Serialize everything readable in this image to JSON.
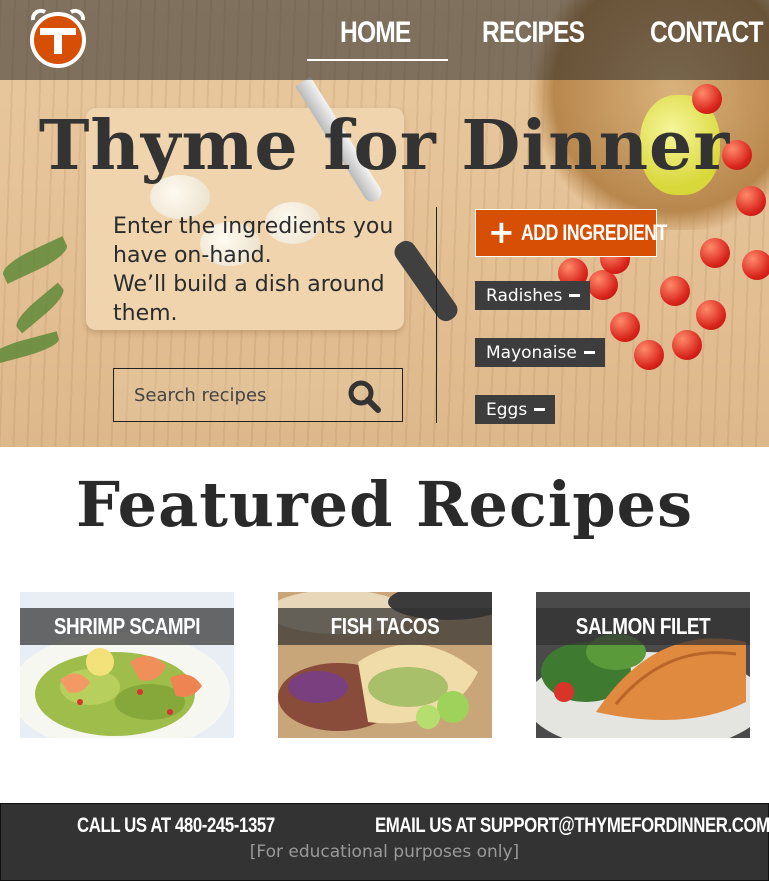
{
  "nav": {
    "logo_icon": "clock-t-logo",
    "links": [
      {
        "label": "HOME",
        "active": true
      },
      {
        "label": "RECIPES",
        "active": false
      },
      {
        "label": "CONTACT",
        "active": false
      }
    ]
  },
  "hero": {
    "title": "Thyme for Dinner",
    "intro_line1": "Enter the ingredients you have on-hand.",
    "intro_line2": "We’ll build a dish around them.",
    "search": {
      "placeholder": "Search recipes",
      "icon": "search-icon"
    },
    "add_button": {
      "label": "ADD INGREDIENT",
      "icon": "plus-icon"
    },
    "ingredients": [
      {
        "label": "Radishes",
        "icon": "minus-icon"
      },
      {
        "label": "Mayonaise",
        "icon": "minus-icon"
      },
      {
        "label": "Eggs",
        "icon": "minus-icon"
      }
    ]
  },
  "featured": {
    "title": "Featured Recipes",
    "recipes": [
      {
        "label": "SHRIMP SCAMPI"
      },
      {
        "label": "FISH TACOS"
      },
      {
        "label": "SALMON FILET"
      }
    ]
  },
  "footer": {
    "phone": "CALL US AT 480-245-1357",
    "email": "EMAIL US AT SUPPORT@THYMEFORDINNER.COM",
    "disclaimer": "[For educational purposes only]"
  },
  "colors": {
    "accent": "#d64f05",
    "dark": "#333333",
    "chip": "#3d3d3d",
    "white": "#ffffff"
  }
}
